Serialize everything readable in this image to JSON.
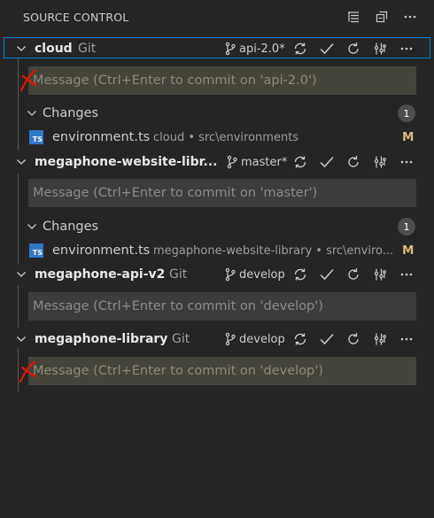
{
  "header": {
    "title": "SOURCE CONTROL",
    "actions": [
      "view-as-tree-icon",
      "collapse-all-icon",
      "more-actions-icon"
    ]
  },
  "repositories": [
    {
      "name": "cloud",
      "provider": "Git",
      "branch": "api-2.0*",
      "message_placeholder": "Message (Ctrl+Enter to commit on 'api-2.0')",
      "changes": {
        "label": "Changes",
        "count": "1",
        "files": [
          {
            "icon": "TS",
            "name": "environment.ts",
            "path": "cloud • src\\environments",
            "status": "M"
          }
        ]
      }
    },
    {
      "name": "megaphone-website-libr...",
      "provider": "",
      "branch": "master*",
      "message_placeholder": "Message (Ctrl+Enter to commit on 'master')",
      "changes": {
        "label": "Changes",
        "count": "1",
        "files": [
          {
            "icon": "TS",
            "name": "environment.ts",
            "path": "megaphone-website-library • src\\enviro...",
            "status": "M"
          }
        ]
      }
    },
    {
      "name": "megaphone-api-v2",
      "provider": "Git",
      "branch": "develop",
      "message_placeholder": "Message (Ctrl+Enter to commit on 'develop')"
    },
    {
      "name": "megaphone-library",
      "provider": "Git",
      "branch": "develop",
      "message_placeholder": "Message (Ctrl+Enter to commit on 'develop')"
    }
  ],
  "colors": {
    "background": "#252526",
    "input_background": "#3c3c3c",
    "focus_border": "#007fd4",
    "modified_status": "#d7ba7d",
    "ts_icon": "#3178c6",
    "annotation_red": "#e51400"
  }
}
